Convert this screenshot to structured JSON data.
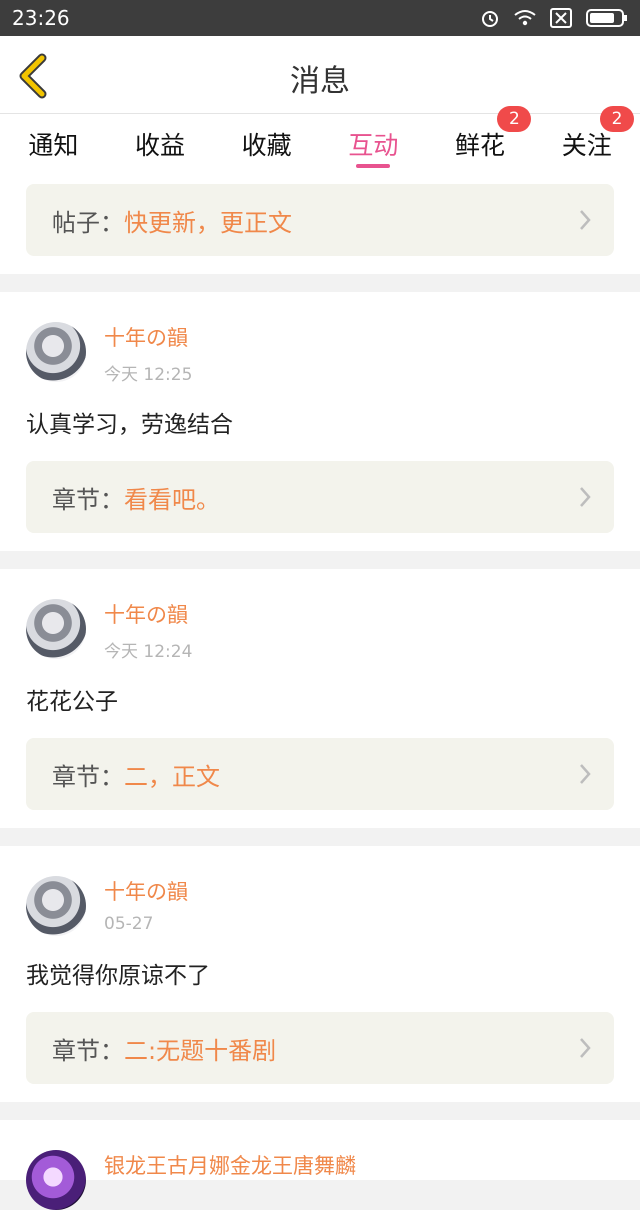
{
  "status_bar": {
    "time": "23:26"
  },
  "header": {
    "title": "消息"
  },
  "tabs": [
    {
      "label": "通知"
    },
    {
      "label": "收益"
    },
    {
      "label": "收藏"
    },
    {
      "label": "互动",
      "active": true
    },
    {
      "label": "鲜花",
      "badge": "2"
    },
    {
      "label": "关注",
      "badge": "2"
    }
  ],
  "top_ref": {
    "label": "帖子：",
    "value": "快更新，更正文"
  },
  "posts": [
    {
      "name": "十年の韻",
      "time": "今天 12:25",
      "text": "认真学习，劳逸结合",
      "ref_label": "章节：",
      "ref_value": "看看吧。"
    },
    {
      "name": "十年の韻",
      "time": "今天 12:24",
      "text": "花花公子",
      "ref_label": "章节：",
      "ref_value": "二，正文"
    },
    {
      "name": "十年の韻",
      "time": "05-27",
      "text": "我觉得你原谅不了",
      "ref_label": "章节：",
      "ref_value": "二:无题十番剧"
    }
  ],
  "last_post": {
    "name": "银龙王古月娜金龙王唐舞麟"
  },
  "colors": {
    "accent": "#e8538f",
    "orange": "#f0884a",
    "badge": "#f04a4a",
    "back_icon": "#f2c400"
  }
}
